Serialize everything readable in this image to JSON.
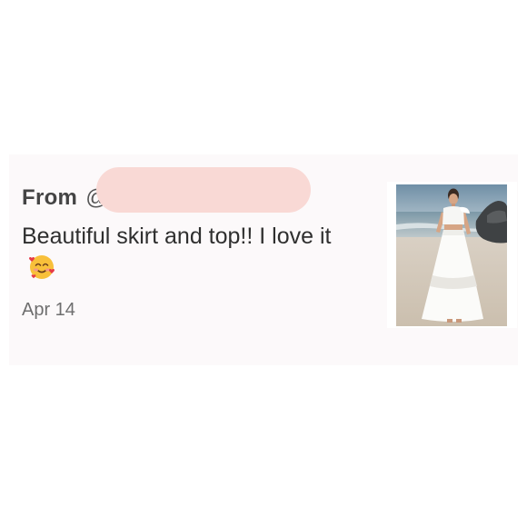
{
  "review": {
    "from_label": "From",
    "username_prefix": "@",
    "message_text": "Beautiful skirt and top!! I love it",
    "emoji": "smiling-face-with-hearts",
    "date": "Apr 14"
  },
  "colors": {
    "card_background": "#fcf9fa",
    "redaction": "#f9d9d5",
    "text_primary": "#2f2f2f",
    "text_secondary": "#6e6e6e"
  }
}
